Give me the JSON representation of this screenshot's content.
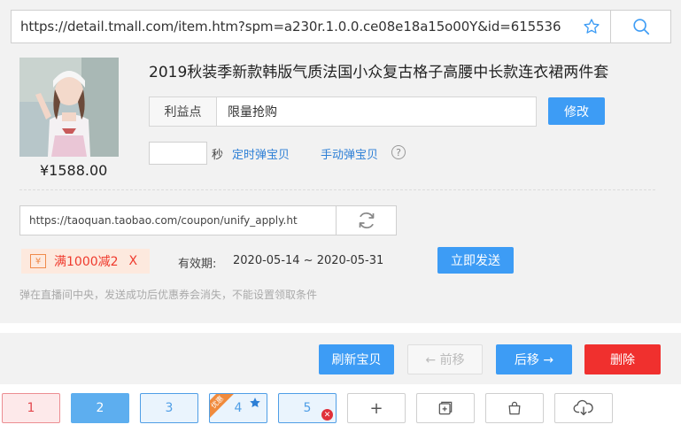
{
  "url": "https://detail.tmall.com/item.htm?spm=a230r.1.0.0.ce08e18a15o00Y&id=615536",
  "product": {
    "title": "2019秋装季新款韩版气质法国小众复古格子高腰中长款连衣裙两件套",
    "price": "¥1588.00"
  },
  "benefit": {
    "label": "利益点",
    "value": "限量抢购",
    "edit_label": "修改"
  },
  "timer": {
    "seconds_value": "",
    "seconds_unit": "秒",
    "timed_link": "定时弹宝贝",
    "manual_link": "手动弹宝贝",
    "help_glyph": "?"
  },
  "coupon": {
    "url": "https://taoquan.taobao.com/coupon/unify_apply.ht",
    "yen_glyph": "¥",
    "title": "满1000减2",
    "remove_glyph": "X",
    "validity_label": "有效期:",
    "validity_value": "2020-05-14 ~ 2020-05-31",
    "send_label": "立即发送",
    "hint": "弹在直播间中央，发送成功后优惠券会消失，不能设置领取条件"
  },
  "actions": {
    "refresh": "刷新宝贝",
    "prev": "← 前移",
    "next": "后移 →",
    "delete": "删除"
  },
  "tabs": [
    {
      "label": "1"
    },
    {
      "label": "2"
    },
    {
      "label": "3"
    },
    {
      "label": "4",
      "corner": "优惠"
    },
    {
      "label": "5"
    }
  ],
  "tools": {
    "add_glyph": "+"
  },
  "colors": {
    "primary": "#3d9cf5",
    "danger": "#f0302e",
    "coupon_red": "#ef3a2d",
    "link": "#2d7fd6"
  },
  "icons": [
    "star-icon",
    "search-icon",
    "refresh-icon",
    "help-icon",
    "yen-icon",
    "star-badge-icon",
    "close-badge-icon",
    "add-icon",
    "copy-icon",
    "bag-icon",
    "cloud-download-icon"
  ]
}
